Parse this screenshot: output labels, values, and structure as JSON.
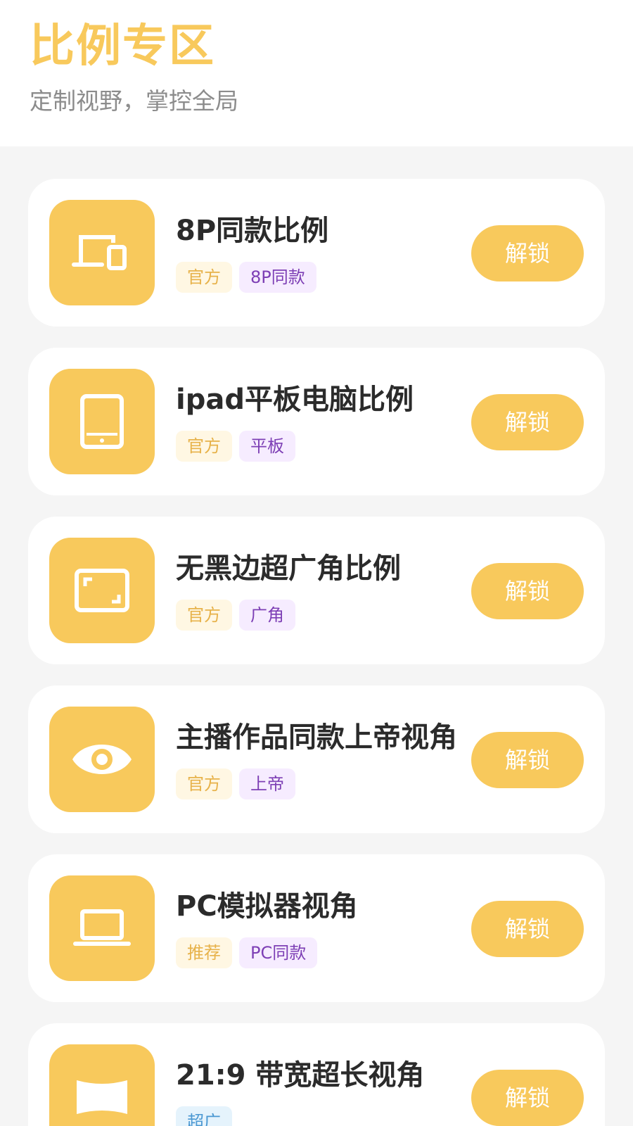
{
  "header": {
    "title": "比例专区",
    "subtitle": "定制视野，掌控全局"
  },
  "colors": {
    "accent": "#f8c95c",
    "tag_official_bg": "#fff7e3",
    "tag_official_text": "#e7b24a",
    "tag_purple_bg": "#f6ecff",
    "tag_purple_text": "#7d3fb5",
    "tag_blue_bg": "#e5f3fc",
    "tag_blue_text": "#4b98d2"
  },
  "items": [
    {
      "icon": "devices-icon",
      "title": "8P同款比例",
      "tags": [
        "官方",
        "8P同款"
      ],
      "button": "解锁"
    },
    {
      "icon": "tablet-icon",
      "title": "ipad平板电脑比例",
      "tags": [
        "官方",
        "平板"
      ],
      "button": "解锁"
    },
    {
      "icon": "fullscreen-frame-icon",
      "title": "无黑边超广角比例",
      "tags": [
        "官方",
        "广角"
      ],
      "button": "解锁"
    },
    {
      "icon": "eye-icon",
      "title": "主播作品同款上帝视角",
      "tags": [
        "官方",
        "上帝"
      ],
      "button": "解锁"
    },
    {
      "icon": "laptop-icon",
      "title": "PC模拟器视角",
      "tags": [
        "推荐",
        "PC同款"
      ],
      "button": "解锁"
    },
    {
      "icon": "ultrawide-icon",
      "title": "21:9 带宽超长视角",
      "tags": [
        "超广"
      ],
      "button": "解锁"
    }
  ]
}
